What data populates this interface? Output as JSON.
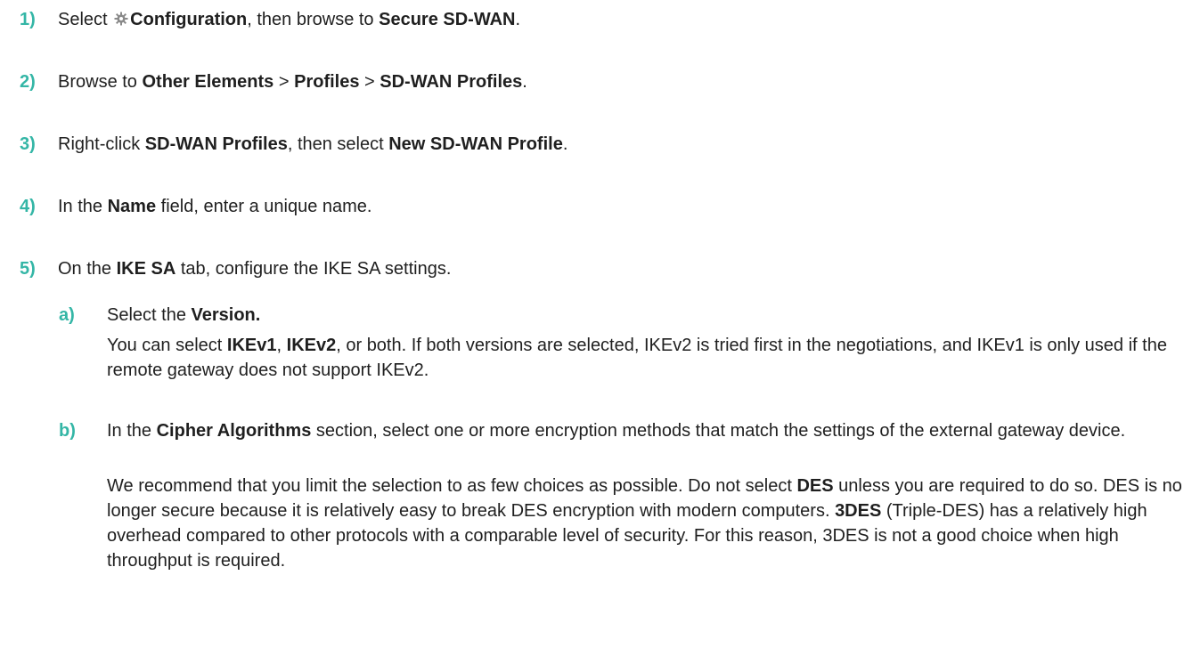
{
  "steps": [
    {
      "num": "1)",
      "parts": [
        "Select ",
        "gear-icon",
        "Configuration",
        ", then browse to ",
        "Secure SD-WAN",
        "."
      ]
    },
    {
      "num": "2)",
      "t1": "Browse to ",
      "b1": "Other Elements",
      "t2": " > ",
      "b2": "Profiles",
      "t3": " > ",
      "b3": "SD-WAN Profiles",
      "t4": "."
    },
    {
      "num": "3)",
      "t1": "Right-click ",
      "b1": "SD-WAN Profiles",
      "t2": ", then select ",
      "b2": "New SD-WAN Profile",
      "t3": "."
    },
    {
      "num": "4)",
      "t1": "In the ",
      "b1": "Name",
      "t2": " field, enter a unique name."
    },
    {
      "num": "5)",
      "t1": "On the ",
      "b1": "IKE SA",
      "t2": " tab, configure the IKE SA settings."
    }
  ],
  "step1": {
    "t1": "Select",
    "b1": "Configuration",
    "t2": ", then browse to ",
    "b2": "Secure SD-WAN",
    "t3": "."
  },
  "substeps": {
    "a": {
      "num": "a)",
      "t1": "Select the ",
      "b1": "Version.",
      "p_t1": "You can select ",
      "p_b1": "IKEv1",
      "p_t2": ", ",
      "p_b2": "IKEv2",
      "p_t3": ", or both. If both versions are selected, IKEv2 is tried first in the negotiations, and IKEv1 is only used if the remote gateway does not support IKEv2."
    },
    "b": {
      "num": "b)",
      "t1": "In the ",
      "b1": "Cipher Algorithms",
      "t2": " section, select one or more encryption methods that match the settings of the external gateway device.",
      "p_t1": "We recommend that you limit the selection to as few choices as possible. Do not select ",
      "p_b1": "DES",
      "p_t2": " unless you are required to do so. DES is no longer secure because it is relatively easy to break DES encryption with modern computers. ",
      "p_b2": "3DES",
      "p_t3": " (Triple-DES) has a relatively high overhead compared to other protocols with a comparable level of security. For this reason, 3DES is not a good choice when high throughput is required."
    }
  },
  "colors": {
    "step_number": "#34b6a6",
    "text": "#1f1f1f"
  }
}
